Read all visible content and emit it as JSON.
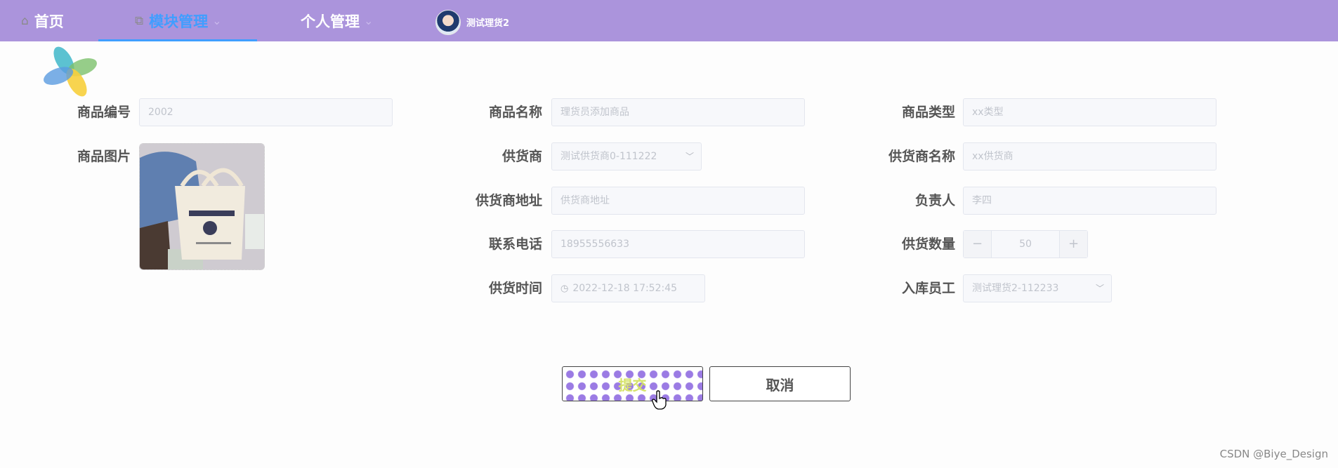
{
  "nav": {
    "home": "首页",
    "module": "模块管理",
    "personal": "个人管理",
    "user_name": "测试理货2"
  },
  "form": {
    "code_label": "商品编号",
    "code_value": "2002",
    "name_label": "商品名称",
    "name_value": "理货员添加商品",
    "type_label": "商品类型",
    "type_value": "xx类型",
    "image_label": "商品图片",
    "supplier_label": "供货商",
    "supplier_value": "测试供货商0-111222",
    "supplier_name_label": "供货商名称",
    "supplier_name_value": "xx供货商",
    "supplier_addr_label": "供货商地址",
    "supplier_addr_placeholder": "供货商地址",
    "manager_label": "负责人",
    "manager_value": "李四",
    "phone_label": "联系电话",
    "phone_value": "18955556633",
    "quantity_label": "供货数量",
    "quantity_value": "50",
    "time_label": "供货时间",
    "time_value": "2022-12-18 17:52:45",
    "staff_label": "入库员工",
    "staff_value": "测试理货2-112233"
  },
  "actions": {
    "submit": "提交",
    "cancel": "取消"
  },
  "watermark": "CSDN @Biye_Design",
  "colors": {
    "topbar": "#ab94dc",
    "active_nav": "#409eff",
    "submit_dots": "#9b7be4"
  }
}
